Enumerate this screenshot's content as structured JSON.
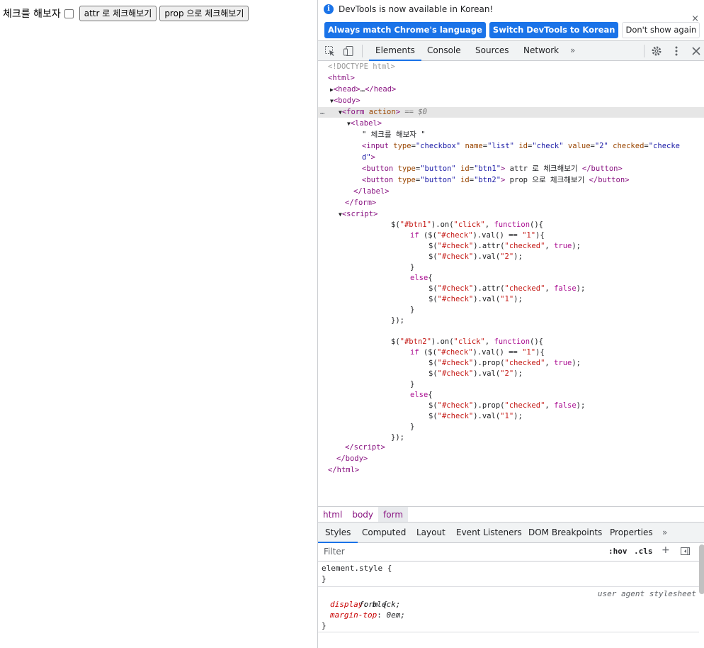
{
  "page": {
    "label_text": "체크를 해보자",
    "checkbox_checked": false,
    "btn1_label": "attr 로 체크해보기",
    "btn2_label": "prop 으로 체크해보기"
  },
  "infobar": {
    "message": "DevTools is now available in Korean!",
    "btn_match": "Always match Chrome's language",
    "btn_switch": "Switch DevTools to Korean",
    "btn_dismiss": "Don't show again",
    "close": "×"
  },
  "toolbar": {
    "tabs": [
      "Elements",
      "Console",
      "Sources",
      "Network"
    ],
    "more": "»",
    "active_tab": "Elements"
  },
  "dom": {
    "doctype": "<!DOCTYPE html>",
    "label_text": "\" 체크를 해보자 \"",
    "btn1_text": " attr 로 체크해보기 ",
    "btn2_text": " prop 으로 체크해보기 ",
    "selected_marker": " == $0",
    "ellipsis": "…"
  },
  "breadcrumbs": [
    "html",
    "body",
    "form"
  ],
  "subtabs": {
    "tabs": [
      "Styles",
      "Computed",
      "Layout",
      "Event Listeners",
      "DOM Breakpoints",
      "Properties"
    ],
    "more": "»"
  },
  "filter": {
    "placeholder": "Filter",
    "hov": ":hov",
    "cls": ".cls",
    "add": "+"
  },
  "styles": {
    "element_style": "element.style {",
    "close": "}",
    "form_selector": "form {",
    "ua_source": "user agent stylesheet",
    "props": [
      {
        "name": "display",
        "value": "block;"
      },
      {
        "name": "margin-top",
        "value": "0em;"
      }
    ]
  },
  "colors": {
    "accent": "#1a73e8",
    "tag": "#881280",
    "attr": "#994500",
    "value": "#1a1aa6"
  }
}
